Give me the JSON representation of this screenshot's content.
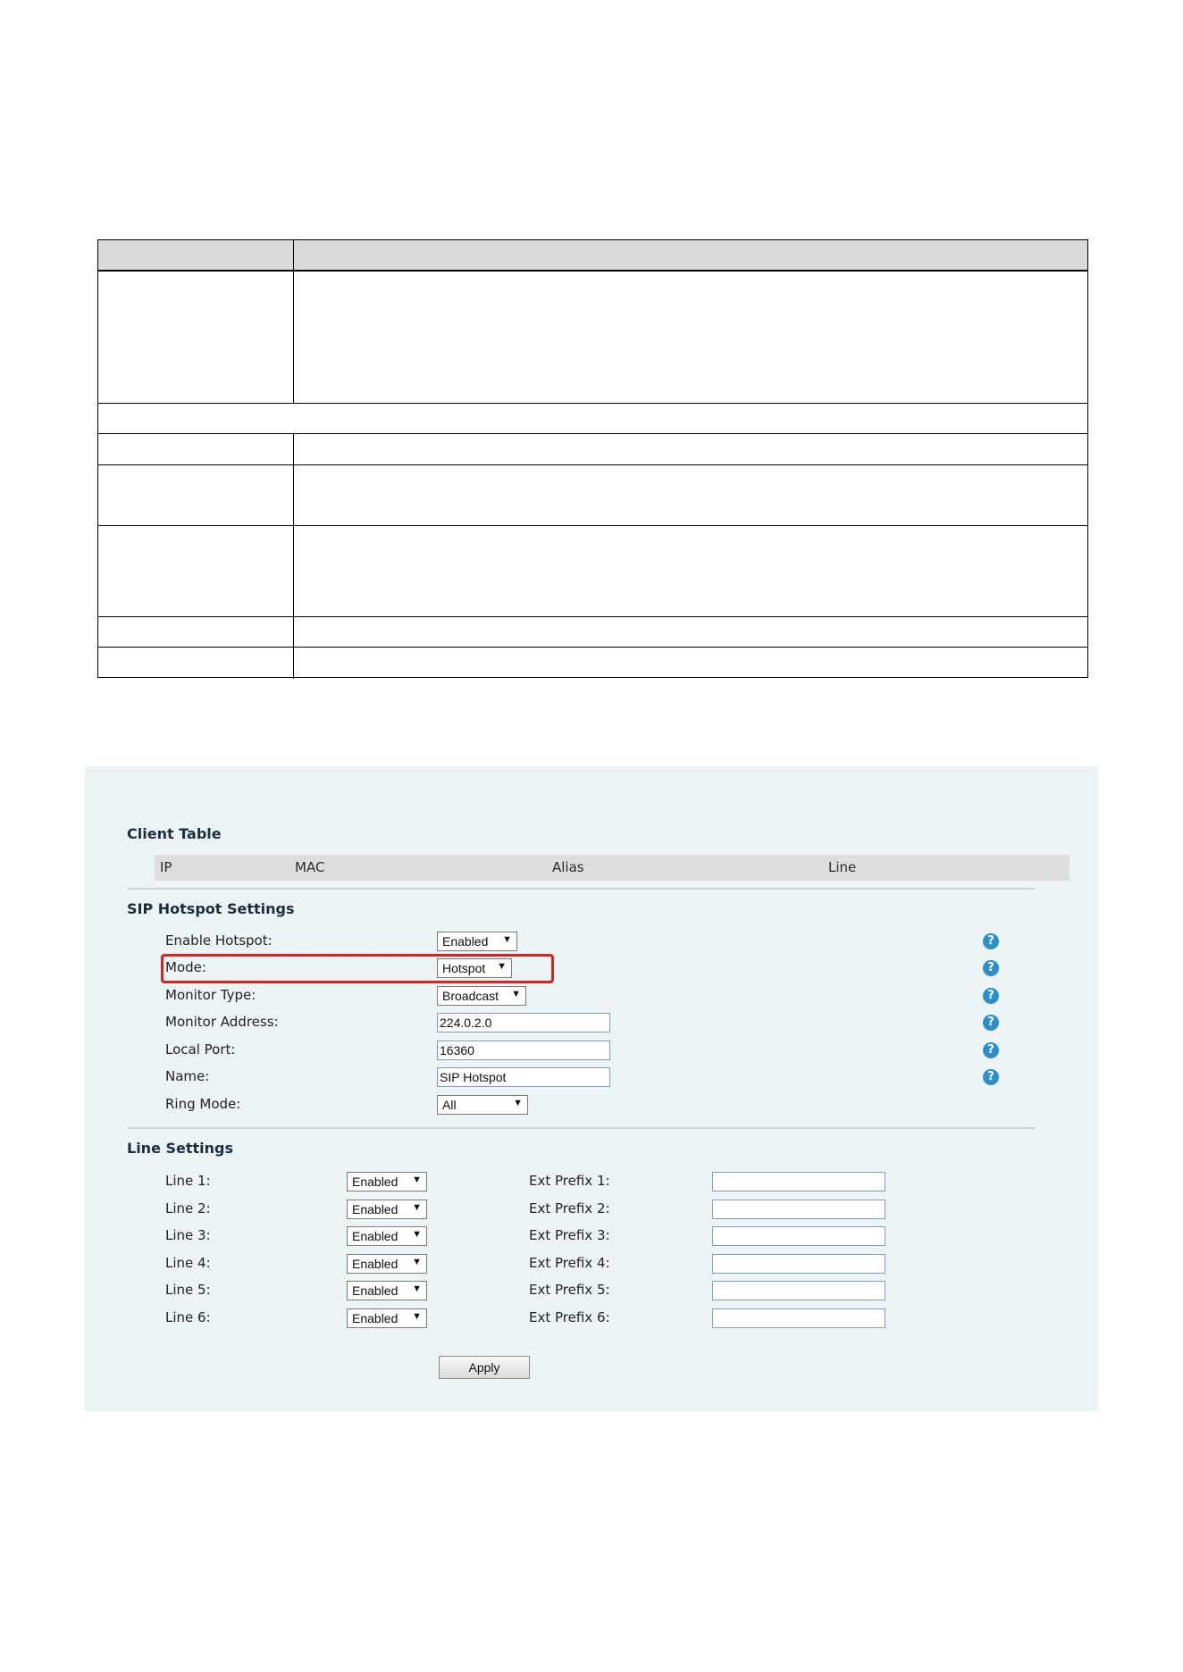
{
  "colors": {
    "panel_background": "#edf4f6",
    "highlight_border": "#e0201c",
    "help_icon": "#2b8fc9"
  },
  "client_table": {
    "title": "Client Table",
    "columns": [
      "IP",
      "MAC",
      "Alias",
      "Line"
    ]
  },
  "hotspot": {
    "title": "SIP Hotspot Settings",
    "enable_label": "Enable Hotspot:",
    "enable_value": "Enabled",
    "mode_label": "Mode:",
    "mode_value": "Hotspot",
    "monitor_type_label": "Monitor Type:",
    "monitor_type_value": "Broadcast",
    "monitor_address_label": "Monitor Address:",
    "monitor_address_value": "224.0.2.0",
    "local_port_label": "Local Port:",
    "local_port_value": "16360",
    "name_label": "Name:",
    "name_value": "SIP Hotspot",
    "ring_mode_label": "Ring Mode:",
    "ring_mode_value": "All",
    "help_icon_glyph": "?"
  },
  "line_settings": {
    "title": "Line Settings",
    "lines": [
      {
        "label": "Line 1:",
        "value": "Enabled",
        "prefix_label": "Ext Prefix 1:",
        "prefix_value": ""
      },
      {
        "label": "Line 2:",
        "value": "Enabled",
        "prefix_label": "Ext Prefix 2:",
        "prefix_value": ""
      },
      {
        "label": "Line 3:",
        "value": "Enabled",
        "prefix_label": "Ext Prefix 3:",
        "prefix_value": ""
      },
      {
        "label": "Line 4:",
        "value": "Enabled",
        "prefix_label": "Ext Prefix 4:",
        "prefix_value": ""
      },
      {
        "label": "Line 5:",
        "value": "Enabled",
        "prefix_label": "Ext Prefix 5:",
        "prefix_value": ""
      },
      {
        "label": "Line 6:",
        "value": "Enabled",
        "prefix_label": "Ext Prefix 6:",
        "prefix_value": ""
      }
    ]
  },
  "apply_label": "Apply",
  "dropdown_arrow": "▼"
}
